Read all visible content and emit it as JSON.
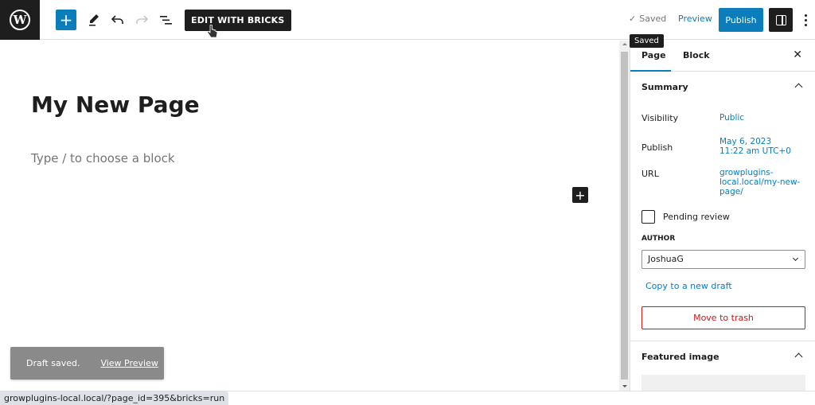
{
  "topbar": {
    "logo_glyph": "W",
    "add_block_icon": "+",
    "edit_with_bricks_label": "EDIT WITH BRICKS",
    "saved_label": "Saved",
    "preview_label": "Preview",
    "publish_label": "Publish",
    "saved_tooltip": "Saved",
    "icons": [
      "wordpress-logo-icon",
      "plus-icon",
      "pencil-icon",
      "undo-icon",
      "redo-icon",
      "list-view-icon",
      "hand-cursor-icon",
      "check-icon",
      "sidebar-panel-icon",
      "more-vertical-icon"
    ]
  },
  "editor": {
    "page_title": "My New Page",
    "block_placeholder": "Type / to choose a block",
    "inline_add_icon": "+"
  },
  "sidebar": {
    "tabs": [
      {
        "label": "Page",
        "active": true
      },
      {
        "label": "Block",
        "active": false
      }
    ],
    "close_icon": "✕",
    "summary": {
      "title": "Summary",
      "rows": [
        {
          "label": "Visibility",
          "value": "Public"
        },
        {
          "label": "Publish",
          "value_line1": "May 6, 2023",
          "value_line2": "11:22 am UTC+0"
        },
        {
          "label": "URL",
          "value_line1": "growplugins-",
          "value_line2": "local.local/my-new-",
          "value_line3": "page/"
        }
      ],
      "pending_review_label": "Pending review",
      "pending_review_checked": false,
      "author_label": "AUTHOR",
      "author_value": "JoshuaG",
      "copy_draft_label": "Copy to a new draft",
      "trash_label": "Move to trash"
    },
    "featured_image": {
      "title": "Featured image"
    }
  },
  "snackbar": {
    "message": "Draft saved.",
    "action_label": "View Preview"
  },
  "statusbar": {
    "url": "growplugins-local.local/?page_id=395&bricks=run"
  },
  "colors": {
    "accent": "#0b7dbb",
    "dark": "#1e1e1e",
    "danger": "#cc1818",
    "snackbar": "#8a8a8a"
  }
}
